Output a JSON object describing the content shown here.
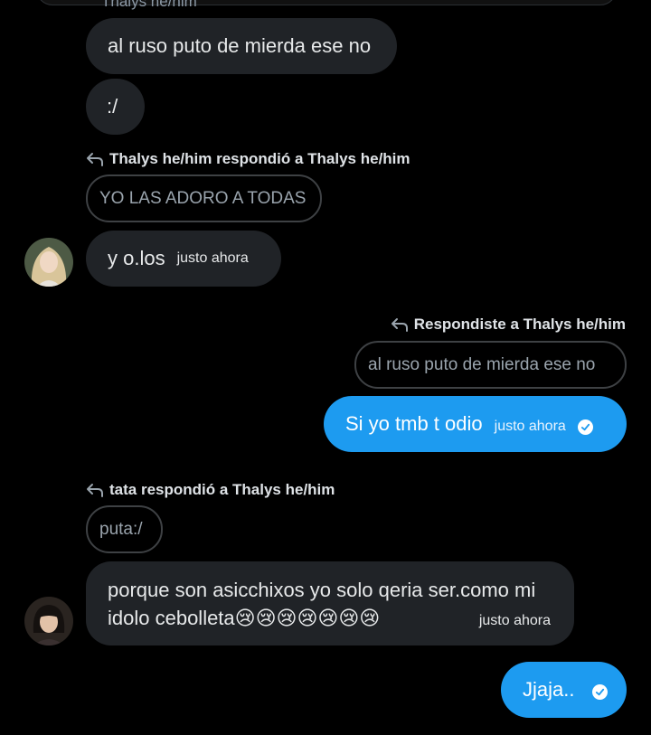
{
  "colors": {
    "background": "#000000",
    "bubble_other": "#202327",
    "bubble_me": "#1d9bf0",
    "quote_border": "#3e4144"
  },
  "cut_sender": "Thalys he/him",
  "messages": [
    {
      "id": "m1",
      "text": "al ruso puto de mierda ese no"
    },
    {
      "id": "m2",
      "text": ":/"
    },
    {
      "id": "m3",
      "reply_header": "Thalys he/him respondió a Thalys he/him",
      "quote": "YO LAS ADORO A TODAS",
      "text": "y o.los",
      "time": "justo ahora",
      "avatar": "avatar-blonde-woman"
    },
    {
      "id": "m4",
      "reply_header": "Respondiste a Thalys he/him",
      "quote": "al ruso puto de mierda ese no",
      "text": "Si yo tmb t odio",
      "time": "justo ahora",
      "status_icon": "check-circle-icon"
    },
    {
      "id": "m5",
      "reply_header": "tata respondió a Thalys he/him",
      "quote": "puta:/",
      "text_line1": "porque son asicchixos yo solo qeria ser.como mi",
      "text_line2": "idolo cebolleta😢😢😢😢😢😢😢",
      "time": "justo ahora",
      "avatar": "avatar-dark-hair-person"
    },
    {
      "id": "m6",
      "text": "Jjaja..",
      "status_icon": "check-circle-icon"
    }
  ]
}
